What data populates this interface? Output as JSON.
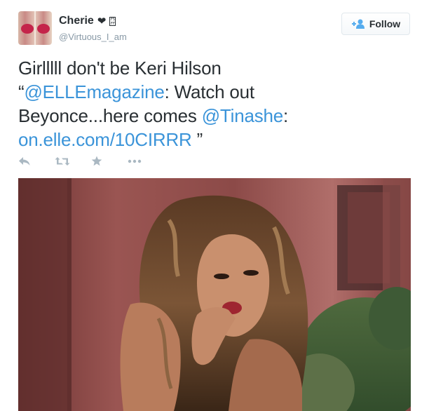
{
  "author": {
    "name": "Cherie",
    "heart": "❤",
    "box_glyph": "F5FF",
    "handle": "@Virtuous_I_am"
  },
  "follow_button": {
    "label": "Follow"
  },
  "tweet": {
    "line1": "Girlllll don't be Keri Hilson",
    "open_quote": "“",
    "mention_elle": "@ELLEmagazine",
    "after_elle": ": Watch out",
    "line3_start": "Beyonce...here comes ",
    "mention_tinashe": "@Tinashe",
    "after_tinashe": ":",
    "link": "on.elle.com/10CIRRR",
    "close_quote": " ”"
  },
  "actions": [
    "reply-icon",
    "retweet-icon",
    "favorite-icon",
    "more-icon"
  ],
  "colors": {
    "link": "#3b94d9",
    "text": "#292f33",
    "muted": "#8899a6",
    "action": "#aab8c2"
  }
}
